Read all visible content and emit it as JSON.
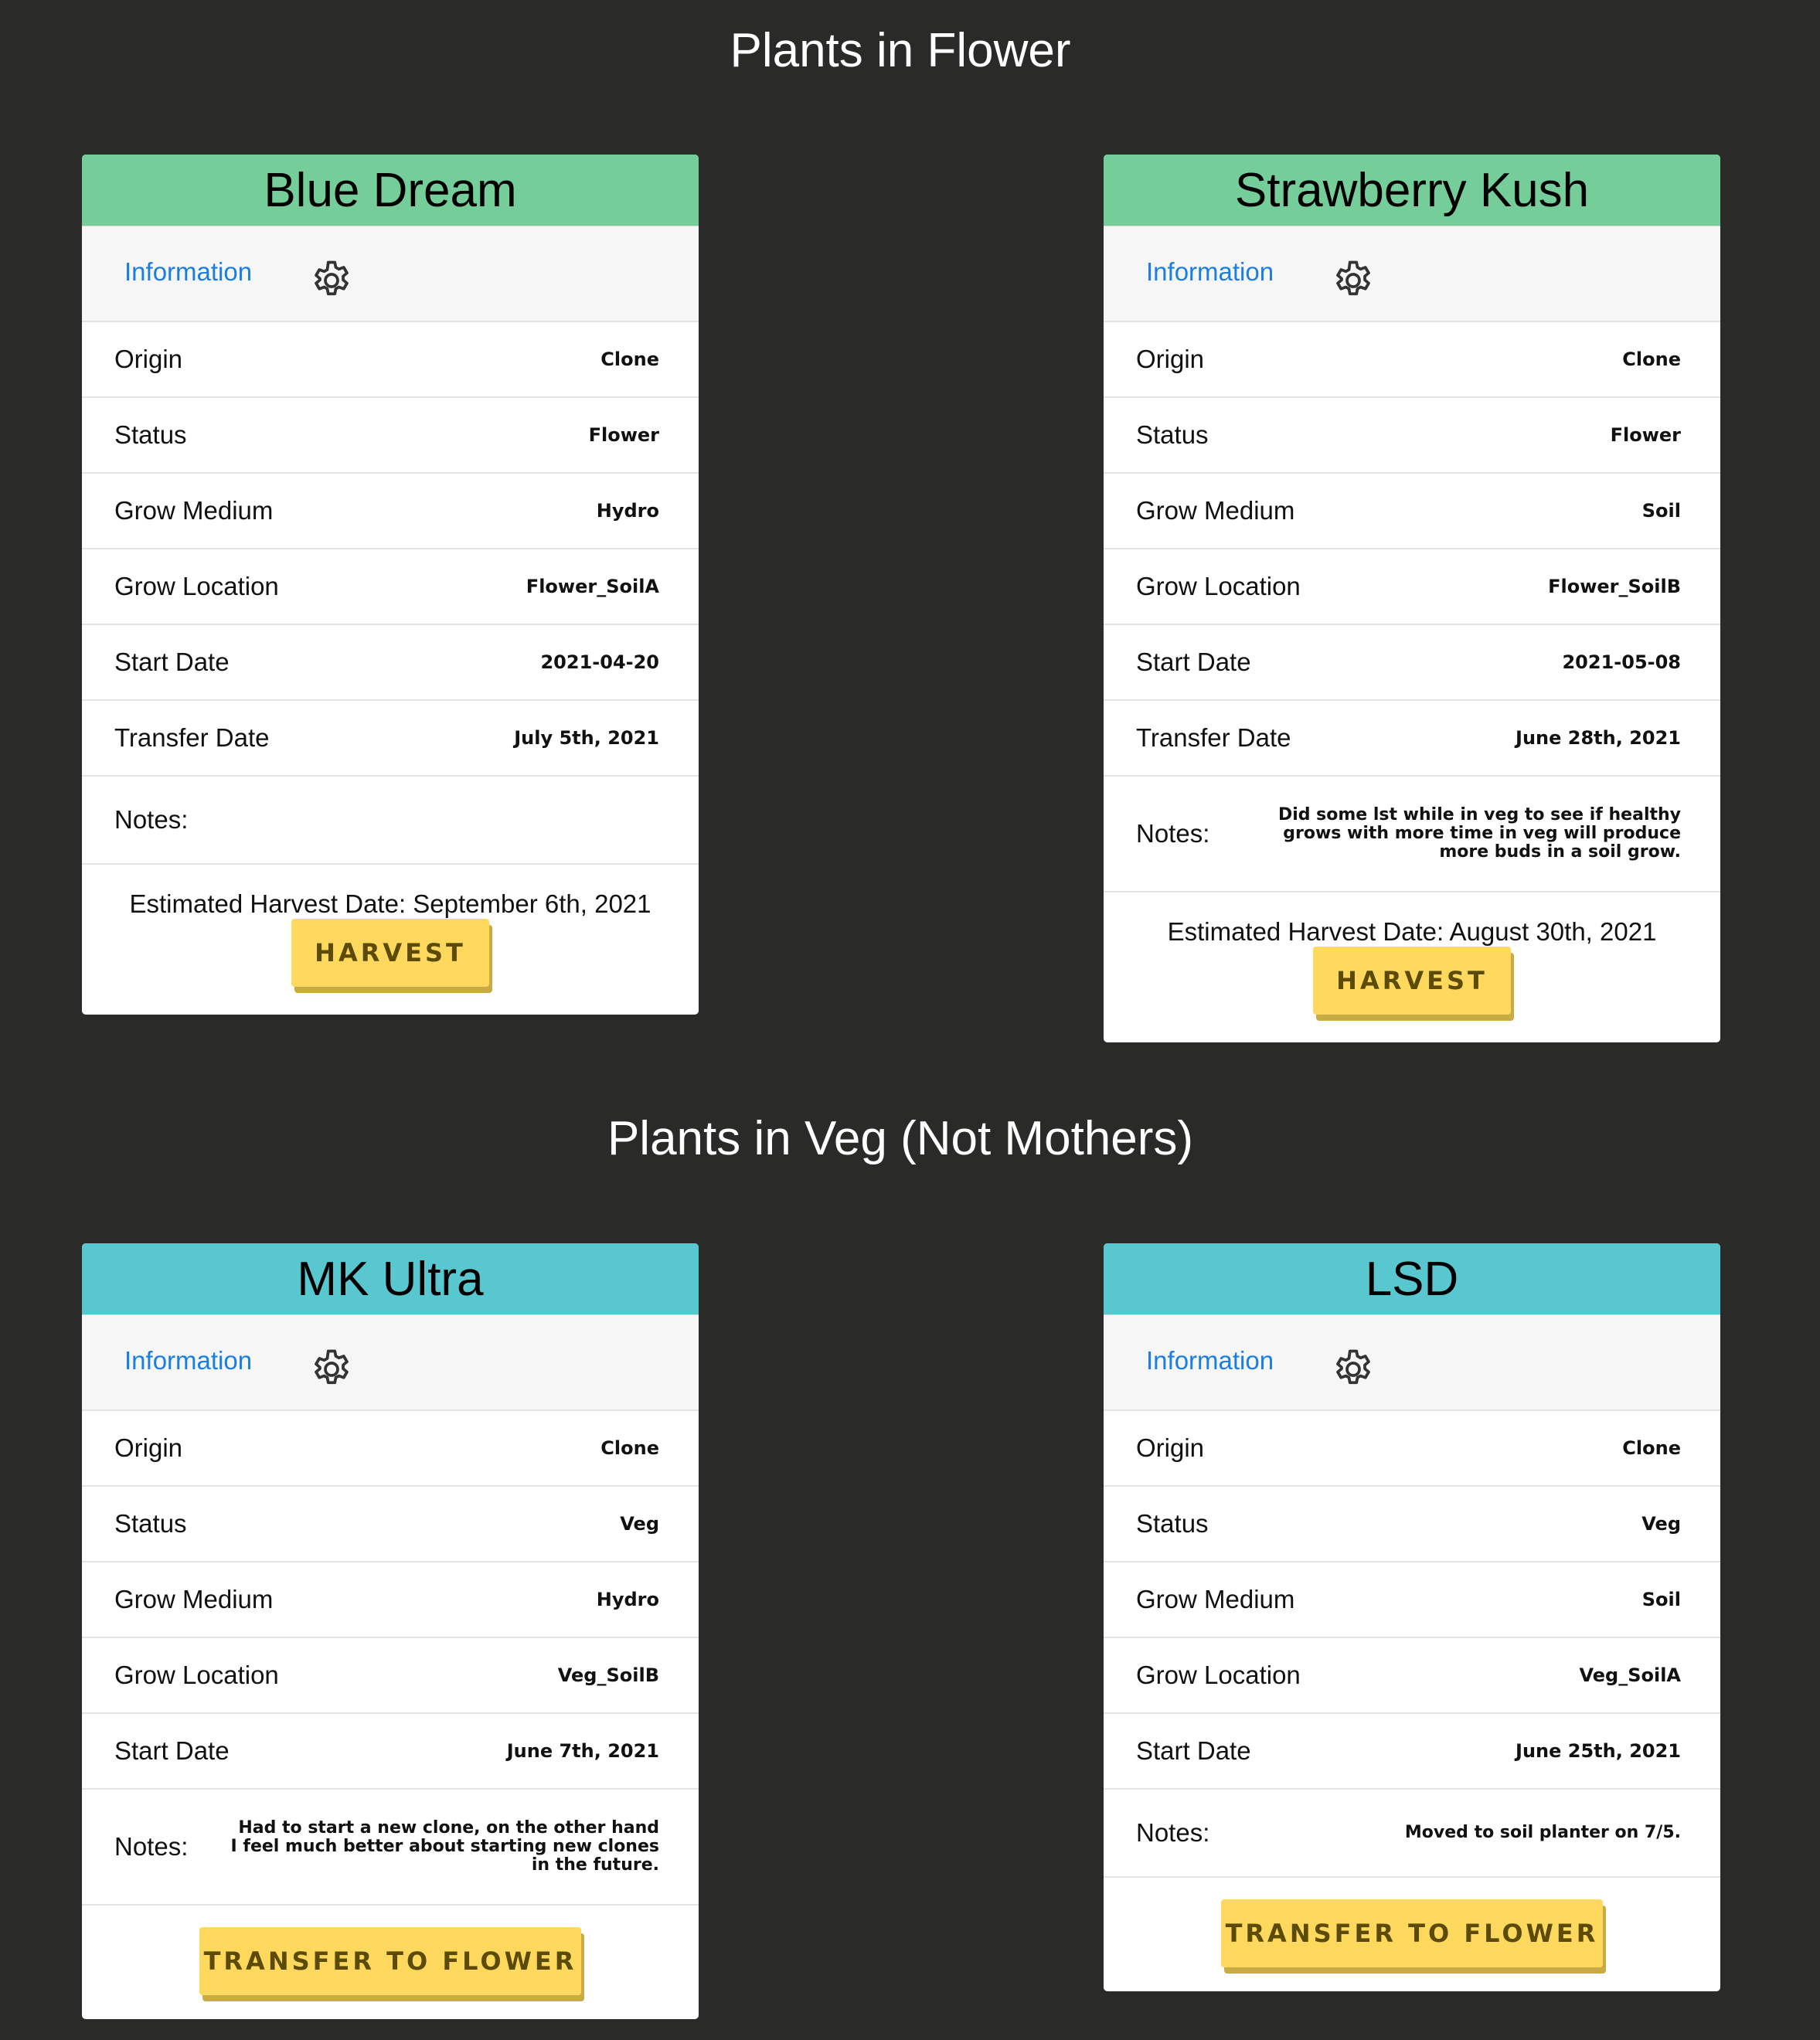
{
  "sections": {
    "flower_title": "Plants in Flower",
    "veg_title": "Plants in Veg (Not Mothers)"
  },
  "common": {
    "info_tab": "Information",
    "origin_label": "Origin",
    "status_label": "Status",
    "medium_label": "Grow Medium",
    "location_label": "Grow Location",
    "start_label": "Start Date",
    "transfer_label": "Transfer Date",
    "notes_label": "Notes:",
    "harvest_button": "HARVEST",
    "transfer_button": "TRANSFER TO FLOWER",
    "settings_icon": "gear-icon"
  },
  "colors": {
    "flower_header": "#75ce9a",
    "veg_header": "#59c7cf",
    "button": "#ffd95e",
    "link": "#1a7ee3",
    "background": "#2a2a29"
  },
  "cards": [
    {
      "name": "Blue Dream",
      "origin": "Clone",
      "status": "Flower",
      "medium": "Hydro",
      "location": "Flower_SoilA",
      "start_date": "2021-04-20",
      "transfer_date": "July 5th, 2021",
      "notes": "",
      "estimated_harvest": "Estimated Harvest Date: September 6th, 2021"
    },
    {
      "name": "Strawberry Kush",
      "origin": "Clone",
      "status": "Flower",
      "medium": "Soil",
      "location": "Flower_SoilB",
      "start_date": "2021-05-08",
      "transfer_date": "June 28th, 2021",
      "notes": "Did some lst while in veg to see if healthy grows with more time in veg will produce more buds in a soil grow.",
      "estimated_harvest": "Estimated Harvest Date: August 30th, 2021"
    },
    {
      "name": "MK Ultra",
      "origin": "Clone",
      "status": "Veg",
      "medium": "Hydro",
      "location": "Veg_SoilB",
      "start_date": "June 7th, 2021",
      "notes": "Had to start a new clone, on the other hand I feel much better about starting new clones in the future."
    },
    {
      "name": "LSD",
      "origin": "Clone",
      "status": "Veg",
      "medium": "Soil",
      "location": "Veg_SoilA",
      "start_date": "June 25th, 2021",
      "notes": "Moved to soil planter on 7/5."
    }
  ]
}
